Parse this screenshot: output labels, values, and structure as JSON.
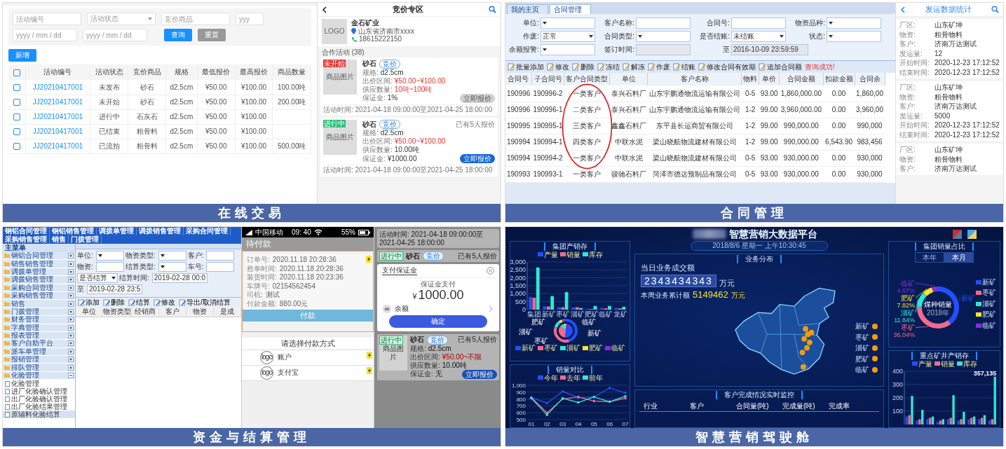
{
  "panels": [
    {
      "kind": "trading",
      "caption": "在线交易",
      "web": {
        "filters": [
          {
            "kind": "text",
            "placeholder": "活动编号"
          },
          {
            "kind": "select",
            "placeholder": "活动状态"
          },
          {
            "kind": "text",
            "placeholder": "竞价商品"
          },
          {
            "kind": "text",
            "placeholder": "yyy"
          }
        ],
        "dates": [
          {
            "placeholder": "yyyy / mm / dd"
          },
          {
            "placeholder": "yyyy / mm / dd"
          }
        ],
        "buttons": [
          {
            "kind": "primary",
            "label": "查询"
          },
          {
            "kind": "secondary",
            "label": "重置"
          }
        ],
        "add_button": "新增",
        "select_all": {
          "checked": false
        },
        "columns": [
          "活动编号",
          "活动状态",
          "竞价商品",
          "规格",
          "最低报价",
          "最高报价",
          "商品数量"
        ],
        "rows": [
          {
            "checked": false,
            "cells": [
              "JJ20210417001",
              "未发布",
              "砂石",
              "d2.5cm",
              "¥50.00",
              "¥100.00",
              "100.00吨"
            ]
          },
          {
            "checked": false,
            "cells": [
              "JJ20210417001",
              "未开始",
              "砂石",
              "d2.5cm",
              "¥50.00",
              "¥100.00",
              "200.00吨"
            ]
          },
          {
            "checked": false,
            "cells": [
              "JJ20210417001",
              "进行中",
              "石灰石",
              "d2.5cm",
              "¥50.00",
              "¥100.00"
            ]
          },
          {
            "checked": false,
            "cells": [
              "JJ20210417001",
              "已结束",
              "粗骨料",
              "d2.5cm",
              "¥50.00",
              "¥100.00"
            ]
          },
          {
            "checked": false,
            "cells": [
              "JJ20210417001",
              "已流拍",
              "粗骨料",
              "d2.5cm",
              "¥50.00",
              "¥100.00",
              "500.00吨"
            ]
          }
        ]
      },
      "mobile": {
        "title": "竞价专区",
        "company": {
          "logo": "LOGO",
          "name": "金石矿业",
          "address": "山东省济南市xxxx",
          "phone": "18615222150"
        },
        "section": "合作活动 (38)",
        "cards": [
          {
            "status": "未开始",
            "color": "#e53935",
            "image": "商品图片",
            "name": "砂石",
            "tag": "竞价",
            "fields": [
              {
                "label": "规格:",
                "value": "d2.5cm",
                "highlight": false
              },
              {
                "label": "出价区间:",
                "value": "¥50.00~¥100.00",
                "highlight": true
              },
              {
                "label": "供应数量:",
                "value": "10吨~100吨",
                "highlight": true
              },
              {
                "label": "保证金:",
                "value": "1%",
                "highlight": false
              }
            ],
            "button": {
              "label": "立即报价",
              "disabled": true
            },
            "footer": "活动时间: 2021-04-18 09:00:00至2021-04-25 18:00:00"
          },
          {
            "status": "进行中",
            "color": "#2bbf7a",
            "image": "商品图片",
            "name": "砂石",
            "tag": "竞价",
            "bidders": "已有5人报价",
            "fields": [
              {
                "label": "规格:",
                "value": "d2.5cm",
                "highlight": false
              },
              {
                "label": "出价区间:",
                "value": "¥50.00~¥100.00",
                "highlight": true
              },
              {
                "label": "供应数量:",
                "value": "10.00吨",
                "highlight": false
              },
              {
                "label": "保证金:",
                "value": "¥1000.00",
                "highlight": false
              }
            ],
            "button": {
              "label": "立即报价",
              "disabled": false
            },
            "footer": "活动时间: 2021-04-18 09:00:00至2021-04-25 18:00:00"
          }
        ]
      }
    },
    {
      "kind": "contract",
      "caption": "合同管理",
      "web": {
        "tabs": [
          {
            "label": "我的主页",
            "selected": false
          },
          {
            "label": "合同管理",
            "selected": true
          }
        ],
        "form": [
          [
            {
              "label": "单位:",
              "kind": "select",
              "disabled": false
            },
            {
              "label": "客户名称:",
              "kind": "text",
              "disabled": false
            },
            {
              "label": "合同号:",
              "kind": "text",
              "disabled": false
            },
            {
              "label": "物资品种:",
              "kind": "select",
              "disabled": false
            }
          ],
          [
            {
              "label": "作废:",
              "kind": "select",
              "value": "正常",
              "disabled": false
            },
            {
              "label": "合同类型:",
              "kind": "select",
              "disabled": false
            },
            {
              "label": "是否结账:",
              "kind": "select",
              "value": "未结账",
              "disabled": false
            },
            {
              "label": "状态:",
              "kind": "select",
              "disabled": false
            }
          ],
          [
            {
              "label": "余额报警:",
              "kind": "select",
              "disabled": false
            },
            {
              "label": "签订时间:",
              "kind": "text",
              "disabled": true
            },
            {
              "label": "至",
              "kind": "text",
              "value": "2016-10-09 23:59:59",
              "disabled": true
            }
          ]
        ],
        "toolbar": [
          "批量添加",
          "修改",
          "删除",
          "冻结",
          "解冻",
          "作废",
          "结账",
          "修改合同有效期",
          "追加合同额"
        ],
        "message": "查询成功!",
        "columns": [
          {
            "label": "合同号",
            "circled": false
          },
          {
            "label": "子合同号",
            "circled": false
          },
          {
            "label": "客户合同类型",
            "circled": true
          },
          {
            "label": "单位",
            "circled": false
          },
          {
            "label": "客户名称",
            "circled": false
          },
          {
            "label": "物料",
            "circled": false
          },
          {
            "label": "单价",
            "circled": false
          },
          {
            "label": "合同金额",
            "circled": false
          },
          {
            "label": "扣款金额",
            "circled": false
          },
          {
            "label": "合同余",
            "circled": false
          }
        ],
        "rows": [
          {
            "circled": true,
            "cells": [
              "190996",
              "190996-2",
              "一类客户",
              "泰兴石料厂",
              "山东宇鹏通物流运输有限公司",
              "0-5",
              "93.00",
              "1,860,000.00",
              "0.00",
              "1,860,00"
            ]
          },
          {
            "circled": true,
            "cells": [
              "190996",
              "190996-1",
              "二类客户",
              "泰兴石料厂",
              "山东宇鹏通物流运输有限公司",
              "1-2",
              "99.00",
              "3,960,000.00",
              "0.00",
              "3,960,00"
            ]
          },
          {
            "circled": true,
            "cells": [
              "190995",
              "190995-1",
              "三类客户",
              "鑫鑫石料厂",
              "东平县长运商贸有限公司",
              "1-2",
              "99.00",
              "990,000.00",
              "0.00",
              "990,000"
            ]
          },
          {
            "circled": true,
            "cells": [
              "190994",
              "190994-1",
              "四类客户",
              "中联水泥",
              "梁山晓航物流建材有限公司",
              "1-2",
              "99.00",
              "990,000.00",
              "6,543.90",
              "983,456"
            ]
          },
          {
            "circled": true,
            "cells": [
              "190994",
              "190994-2",
              "一类客户",
              "中联水泥",
              "梁山晓航物流建材有限公司",
              "0-5",
              "93.00",
              "930,000.00",
              "0.00",
              "930,000"
            ]
          },
          {
            "circled": false,
            "cells": [
              "190993",
              "190993-1",
              "一类客户",
              "骏驰石料厂",
              "菏泽市德达预制品有限公司",
              "0-5",
              "93.00",
              "930,000.00",
              "0.00",
              "930,000"
            ]
          }
        ]
      },
      "mobile": {
        "title": "发运数据统计",
        "records": [
          {
            "fields": [
              {
                "label": "厂区:",
                "value": "山东矿坤"
              },
              {
                "label": "物资:",
                "value": "粗骨物料"
              },
              {
                "label": "客户:",
                "value": "济南万达测试"
              },
              {
                "label": "发运量:",
                "value": "12"
              },
              {
                "label": "开始时间:",
                "value": "2020-12-23 17:12:52"
              },
              {
                "label": "结束时间:",
                "value": "2020-12-23 17:12:52"
              }
            ]
          },
          {
            "fields": [
              {
                "label": "厂区:",
                "value": "山东矿坤"
              },
              {
                "label": "物资:",
                "value": "粗骨物料"
              },
              {
                "label": "客户:",
                "value": "济南万达测试"
              },
              {
                "label": "发运量:",
                "value": "5000"
              },
              {
                "label": "开始时间:",
                "value": "2020-12-23 17:12:52"
              },
              {
                "label": "结束时间:",
                "value": "2020-12-23 17:12:52"
              }
            ]
          },
          {
            "fields": [
              {
                "label": "厂区:",
                "value": "山东矿坤"
              },
              {
                "label": "物资:",
                "value": "粗骨物料"
              },
              {
                "label": "客户:",
                "value": "济南万达测试"
              }
            ]
          }
        ]
      }
    },
    {
      "kind": "finance",
      "caption": "资金与结算管理",
      "system": {
        "menu": [
          "钢铝合同管理",
          "钢铝销售管理",
          "调拨单管理",
          "调拨销售管理",
          "采购合同管理",
          "采购销售管理",
          "销售",
          "门拨管理"
        ],
        "tree_title": "主菜单",
        "tree": [
          {
            "label": "钢铝合同管理",
            "expanded": false
          },
          {
            "label": "销售销售管理",
            "expanded": false
          },
          {
            "label": "调拨单管理",
            "expanded": false
          },
          {
            "label": "调拨销售管理",
            "expanded": false
          },
          {
            "label": "采购合同管理",
            "expanded": false
          },
          {
            "label": "采购销售管理",
            "expanded": false
          },
          {
            "label": "销售",
            "expanded": false
          },
          {
            "label": "门拨管理",
            "expanded": false
          },
          {
            "label": "财务管理",
            "expanded": false
          },
          {
            "label": "字典管理",
            "expanded": false
          },
          {
            "label": "报表管理",
            "expanded": false
          },
          {
            "label": "客户自助平台",
            "expanded": false
          },
          {
            "label": "派车单管理",
            "expanded": false
          },
          {
            "label": "报销管理",
            "expanded": false
          },
          {
            "label": "排队管理",
            "expanded": false
          },
          {
            "label": "化验管理",
            "expanded": true,
            "children": [
              {
                "label": "化验管理",
                "selected": false
              },
              {
                "label": "进厂化验确认管理",
                "selected": false
              },
              {
                "label": "出厂化验确认管理",
                "selected": false
              },
              {
                "label": "出厂化验结果管理",
                "selected": false
              },
              {
                "label": "原辅料化验结算",
                "selected": true
              }
            ]
          }
        ],
        "form": [
          [
            {
              "label": "单位:",
              "kind": "select"
            },
            {
              "label": "物资类型:",
              "kind": "select"
            },
            {
              "label": "客户:",
              "kind": "text"
            }
          ],
          [
            {
              "label": "物资:",
              "kind": "text"
            },
            {
              "label": "结算类型:",
              "kind": "select"
            },
            {
              "label": "车号:",
              "kind": "text"
            }
          ],
          [
            {
              "kind": "select",
              "value": "是否结算"
            },
            {
              "label": "结算时间:",
              "kind": "text",
              "value": "2019-02-28 00:0"
            },
            {
              "label": "至",
              "kind": "text",
              "value": "2019-02-28 23:5"
            }
          ]
        ],
        "toolbar": [
          "添加",
          "删除",
          "结算",
          "修改",
          "导出/取消结算"
        ],
        "columns": [
          "单位",
          "物资类型",
          "经销商",
          "客户",
          "物资",
          "是成"
        ]
      },
      "phone": {
        "carrier": "中国移动",
        "time": "09: 40",
        "battery": "55%",
        "title": "待付款",
        "fields": [
          {
            "label": "订单号:",
            "value": "2020.11.18 20:28:36"
          },
          {
            "label": "抢单时间:",
            "value": "2020.11.18 20:28:36"
          },
          {
            "label": "装货时间:",
            "value": "2020.11.18 20:23:36"
          },
          {
            "label": "车牌号:",
            "value": "02154562454"
          },
          {
            "label": "司机:",
            "value": "测试"
          },
          {
            "label": "付款金额:",
            "value": "880.00元"
          }
        ],
        "pay_button": "付款",
        "method_title": "请选择付款方式",
        "methods": [
          {
            "logo": "logo",
            "label": "账户"
          },
          {
            "logo": "logo",
            "label": "支付宝"
          }
        ]
      },
      "modal_screen": {
        "footer": "活动时间: 2021-04-18 09:00:00至2021-04-25 18:00:00",
        "behind_card": {
          "status": "进行中",
          "name": "砂石",
          "tag": "竞价",
          "bidders": "已有5人报价"
        },
        "modal": {
          "title": "支付保证金",
          "subtitle": "保证金支付",
          "currency": "¥",
          "amount": "1000.00",
          "method": "余额",
          "confirm": "确定"
        },
        "card": {
          "status": "进行中",
          "image": "商品图片",
          "name": "砂石",
          "tag": "竞价",
          "bidders": "已有5人报价",
          "fields": [
            {
              "label": "规格:",
              "value": "d2.5cm",
              "highlight": false
            },
            {
              "label": "出价区间:",
              "value": "¥50.00~不限",
              "highlight": true
            },
            {
              "label": "供应数量:",
              "value": "10.00吨",
              "highlight": false
            },
            {
              "label": "保证金:",
              "value": "无",
              "highlight": false
            }
          ],
          "button": "立即报价"
        }
      }
    },
    {
      "kind": "dashboard",
      "caption": "智慧营销驾驶舱",
      "title": "智慧营销大数据平台",
      "datetime": "2018/8/6 星期一 上午10:30:45",
      "stock": {
        "title": "集团产销存",
        "chart_data": {
          "type": "bar",
          "categories": [
            "集团",
            "新矿",
            "枣矿",
            "淄矿",
            "肥矿",
            "临矿",
            "龙矿"
          ],
          "series": [
            {
              "name": "产量",
              "color": "#2350ff",
              "values": [
                800,
                200,
                150,
                150,
                50,
                100,
                100
              ]
            },
            {
              "name": "销量",
              "color": "#f06b8b",
              "values": [
                750,
                200,
                150,
                150,
                40,
                80,
                80
              ]
            },
            {
              "name": "库存",
              "color": "#2ee8d6",
              "values": [
                2650,
                850,
                1100,
                100,
                230,
                230,
                180
              ]
            }
          ],
          "ylim": [
            0,
            3000
          ],
          "yticks": [
            {
              "value": 0,
              "label": "0"
            },
            {
              "value": 500,
              "label": "500"
            },
            {
              "value": 1000,
              "label": "1,000"
            },
            {
              "value": 1500,
              "label": "1,500"
            },
            {
              "value": 2000,
              "label": "2,000"
            },
            {
              "value": 2500,
              "label": "2,500"
            },
            {
              "value": 3000,
              "label": "3,000"
            }
          ],
          "grid": true
        }
      },
      "mix": {
        "labels": [
          "肥矿",
          "临矿",
          "淄矿",
          "新矿",
          "枣矿"
        ],
        "legend": [
          {
            "label": "新矿",
            "color": "#2350ff"
          },
          {
            "label": "枣矿",
            "color": "#f06b8b"
          },
          {
            "label": "淄矿",
            "color": "#2ee8d6"
          },
          {
            "label": "肥矿",
            "color": "#f5e52a"
          },
          {
            "label": "临矿",
            "color": "#8a2be2"
          }
        ]
      },
      "compare": {
        "title": "销量对比",
        "chart_data": {
          "type": "line",
          "x": [
            "01",
            "02",
            "03",
            "04",
            "05",
            "06",
            "07"
          ],
          "series": [
            {
              "name": "今年",
              "color": "#2350ff",
              "values": [
                820,
                740,
                910,
                820,
                830,
                960,
                890
              ]
            },
            {
              "name": "去年",
              "color": "#f06b8b",
              "values": [
                820,
                600,
                800,
                830,
                770,
                760,
                810
              ]
            },
            {
              "name": "前年",
              "color": "#2ee8d6",
              "values": [
                810,
                570,
                810,
                750,
                830,
                760,
                840
              ]
            }
          ],
          "ylim": [
            500,
            1000
          ],
          "yticks": [
            {
              "value": 500,
              "label": "500"
            },
            {
              "value": 600,
              "label": "600"
            },
            {
              "value": 700,
              "label": "700"
            },
            {
              "value": 800,
              "label": "800"
            },
            {
              "value": 900,
              "label": "900"
            },
            {
              "value": 1000,
              "label": "1,000"
            }
          ],
          "grid": true
        }
      },
      "business": {
        "title": "业务分布",
        "today_label": "当日业务成交额",
        "today_value": "2343434343",
        "unit": "万元",
        "week_label": "本周业务累计额",
        "week_value": "5149462",
        "week_unit": "万元",
        "legend": [
          "新矿",
          "枣矿",
          "淄矿",
          "肥矿",
          "临矿"
        ]
      },
      "monitor": {
        "title": "客户完成情况实时监控",
        "columns": [
          "行业",
          "客户",
          "合同量(吨)",
          "完成量(吨)",
          "完成率"
        ]
      },
      "share": {
        "title": "集团销量占比",
        "toggle": [
          {
            "label": "本年",
            "selected": false
          },
          {
            "label": "本月",
            "selected": true
          }
        ],
        "center_title": "煤种销量",
        "center_sub": "2018年",
        "chart_data": {
          "type": "donut",
          "categories": [
            "新矿",
            "枣矿",
            "淄矿",
            "肥矿",
            "临矿"
          ],
          "series": [
            {
              "values": [
                39.63,
                36.04,
                11.84,
                7.82,
                4.67
              ]
            }
          ],
          "value_labels": [
            null,
            "36.04%",
            "11.84%",
            "7.82%",
            "4.67%"
          ]
        },
        "legend": [
          {
            "label": "新矿",
            "color": "#2350ff"
          },
          {
            "label": "枣矿",
            "color": "#f06b8b"
          },
          {
            "label": "淄矿",
            "color": "#2ee8d6"
          },
          {
            "label": "肥矿",
            "color": "#f5e52a"
          },
          {
            "label": "临矿",
            "color": "#8a2be2"
          }
        ]
      },
      "mine": {
        "title": "重点矿井产销存",
        "peak_label": "357,135",
        "chart_data": {
          "type": "bar",
          "series": [
            {
              "name": "产量",
              "color": "#2350ff",
              "values": [
                60,
                30,
                40,
                20,
                40,
                30,
                40,
                40,
                30
              ]
            },
            {
              "name": "销量",
              "color": "#f06b8b",
              "values": [
                70,
                40,
                50,
                30,
                50,
                40,
                50,
                50,
                40
              ]
            },
            {
              "name": "库存",
              "color": "#2ee8d6",
              "values": [
                215,
                110,
                60,
                40,
                220,
                95,
                60,
                70,
                360
              ]
            }
          ],
          "ylim": [
            0,
            400
          ],
          "yticks": [
            {
              "value": 100,
              "label": "100"
            },
            {
              "value": 200,
              "label": "200"
            },
            {
              "value": 300,
              "label": "300"
            },
            {
              "value": 400,
              "label": "400"
            }
          ],
          "grid": true
        }
      }
    }
  ]
}
